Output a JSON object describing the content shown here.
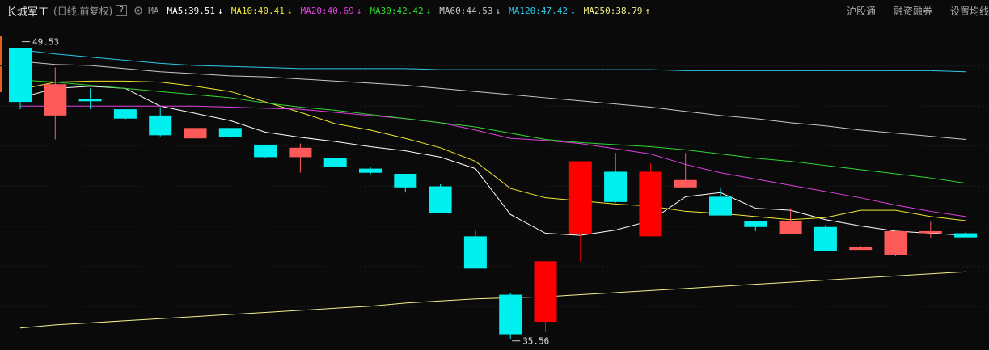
{
  "header": {
    "stock_name": "长城军工",
    "period_label": "(日线,前复权)",
    "help_label": "?",
    "ma_tag": "MA",
    "ma_items": [
      {
        "label": "MA5:39.51",
        "arrow": "↓",
        "color": "#ffffff"
      },
      {
        "label": "MA10:40.41",
        "arrow": "↓",
        "color": "#f2e830"
      },
      {
        "label": "MA20:40.69",
        "arrow": "↓",
        "color": "#e040e0"
      },
      {
        "label": "MA30:42.42",
        "arrow": "↓",
        "color": "#2fd82f"
      },
      {
        "label": "MA60:44.53",
        "arrow": "↓",
        "color": "#c8c8c8"
      },
      {
        "label": "MA120:47.42",
        "arrow": "↓",
        "color": "#2fc8e8"
      },
      {
        "label": "MA250:38.79",
        "arrow": "↑",
        "color": "#f4f08c"
      }
    ],
    "right_links": [
      "沪股通",
      "融资融券",
      "设置均线"
    ]
  },
  "chart_data": {
    "type": "candlestick",
    "y_range": [
      35.2,
      50.6
    ],
    "max_label": "49.53",
    "min_label": "35.56",
    "up_color": "#ff5a5a",
    "up_color_strong": "#ff0000",
    "down_color": "#00f0f0",
    "candles": [
      {
        "o": 49.53,
        "c": 46.95,
        "h": 49.53,
        "l": 46.6
      },
      {
        "o": 46.3,
        "c": 47.8,
        "h": 48.6,
        "l": 45.15
      },
      {
        "o": 47.1,
        "c": 46.98,
        "h": 47.6,
        "l": 46.6
      },
      {
        "o": 46.6,
        "c": 46.15,
        "h": 46.6,
        "l": 46.1
      },
      {
        "o": 46.3,
        "c": 45.35,
        "h": 46.7,
        "l": 45.3
      },
      {
        "o": 45.2,
        "c": 45.7,
        "h": 45.7,
        "l": 45.2
      },
      {
        "o": 45.7,
        "c": 45.25,
        "h": 45.7,
        "l": 45.2
      },
      {
        "o": 44.9,
        "c": 44.3,
        "h": 44.9,
        "l": 44.25
      },
      {
        "o": 44.3,
        "c": 44.75,
        "h": 44.95,
        "l": 43.55
      },
      {
        "o": 44.25,
        "c": 43.85,
        "h": 44.25,
        "l": 43.85
      },
      {
        "o": 43.75,
        "c": 43.55,
        "h": 43.85,
        "l": 43.45
      },
      {
        "o": 43.5,
        "c": 42.85,
        "h": 43.5,
        "l": 42.6
      },
      {
        "o": 42.9,
        "c": 41.6,
        "h": 43.0,
        "l": 41.6
      },
      {
        "o": 40.5,
        "c": 38.95,
        "h": 40.8,
        "l": 38.95
      },
      {
        "o": 37.7,
        "c": 35.8,
        "h": 37.8,
        "l": 35.56
      },
      {
        "o": 36.4,
        "c": 39.3,
        "h": 39.3,
        "l": 35.9
      },
      {
        "o": 40.6,
        "c": 44.1,
        "h": 44.1,
        "l": 39.3
      },
      {
        "o": 43.6,
        "c": 42.15,
        "h": 44.5,
        "l": 42.1
      },
      {
        "o": 40.5,
        "c": 43.6,
        "h": 44.0,
        "l": 40.5
      },
      {
        "o": 42.85,
        "c": 43.2,
        "h": 44.5,
        "l": 42.8
      },
      {
        "o": 42.4,
        "c": 41.5,
        "h": 42.8,
        "l": 41.5
      },
      {
        "o": 41.25,
        "c": 40.95,
        "h": 41.25,
        "l": 40.75
      },
      {
        "o": 40.6,
        "c": 41.25,
        "h": 41.85,
        "l": 40.6
      },
      {
        "o": 40.95,
        "c": 39.8,
        "h": 41.05,
        "l": 39.8
      },
      {
        "o": 39.85,
        "c": 40.0,
        "h": 40.05,
        "l": 39.85
      },
      {
        "o": 39.6,
        "c": 40.75,
        "h": 40.75,
        "l": 39.55
      },
      {
        "o": 40.65,
        "c": 40.75,
        "h": 41.2,
        "l": 40.4
      },
      {
        "o": 40.65,
        "c": 40.45,
        "h": 40.7,
        "l": 40.45
      }
    ],
    "ma_series": [
      {
        "name": "MA5",
        "color": "#ffffff",
        "values": [
          47.15,
          47.6,
          47.7,
          47.6,
          46.75,
          46.4,
          46.05,
          45.5,
          45.25,
          45.05,
          44.8,
          44.6,
          44.3,
          43.75,
          41.55,
          40.65,
          40.55,
          40.8,
          41.25,
          42.4,
          42.6,
          41.85,
          41.75,
          41.3,
          41.0,
          40.75,
          40.65,
          40.55
        ]
      },
      {
        "name": "MA10",
        "color": "#f2e830",
        "values": [
          47.55,
          47.9,
          47.95,
          47.95,
          47.9,
          47.7,
          47.45,
          46.95,
          46.45,
          45.9,
          45.6,
          45.2,
          44.75,
          44.1,
          42.8,
          42.35,
          42.2,
          42.05,
          41.95,
          41.7,
          41.6,
          41.45,
          41.3,
          41.4,
          41.75,
          41.75,
          41.45,
          41.25
        ]
      },
      {
        "name": "MA20",
        "color": "#e040e0",
        "values": [
          46.75,
          46.75,
          46.75,
          46.75,
          46.75,
          46.75,
          46.7,
          46.65,
          46.6,
          46.45,
          46.3,
          46.15,
          45.95,
          45.6,
          45.2,
          45.1,
          44.95,
          44.7,
          44.45,
          43.95,
          43.55,
          43.25,
          42.95,
          42.65,
          42.35,
          42.0,
          41.7,
          41.45
        ]
      },
      {
        "name": "MA30",
        "color": "#2fd82f",
        "values": [
          48.0,
          47.9,
          47.75,
          47.6,
          47.45,
          47.3,
          47.15,
          46.9,
          46.7,
          46.55,
          46.35,
          46.15,
          45.95,
          45.75,
          45.45,
          45.15,
          45.0,
          44.9,
          44.8,
          44.65,
          44.45,
          44.25,
          44.1,
          43.9,
          43.7,
          43.5,
          43.3,
          43.05
        ]
      },
      {
        "name": "MA60",
        "color": "#c8c8c8",
        "values": [
          48.9,
          48.75,
          48.7,
          48.55,
          48.4,
          48.3,
          48.2,
          48.15,
          48.05,
          47.95,
          47.85,
          47.75,
          47.6,
          47.45,
          47.3,
          47.15,
          47.0,
          46.85,
          46.7,
          46.5,
          46.3,
          46.15,
          45.95,
          45.8,
          45.6,
          45.45,
          45.3,
          45.15
        ]
      },
      {
        "name": "MA120",
        "color": "#2fc8e8",
        "values": [
          49.45,
          49.25,
          49.1,
          48.95,
          48.8,
          48.7,
          48.65,
          48.6,
          48.55,
          48.55,
          48.55,
          48.55,
          48.5,
          48.5,
          48.5,
          48.5,
          48.5,
          48.5,
          48.5,
          48.45,
          48.45,
          48.45,
          48.45,
          48.45,
          48.45,
          48.45,
          48.45,
          48.4
        ]
      },
      {
        "name": "MA250",
        "color": "#f4f08c",
        "values": [
          36.1,
          36.25,
          36.35,
          36.45,
          36.55,
          36.65,
          36.75,
          36.85,
          36.95,
          37.05,
          37.15,
          37.3,
          37.4,
          37.5,
          37.55,
          37.6,
          37.7,
          37.8,
          37.9,
          38.0,
          38.1,
          38.2,
          38.3,
          38.4,
          38.5,
          38.6,
          38.7,
          38.8
        ]
      }
    ]
  }
}
